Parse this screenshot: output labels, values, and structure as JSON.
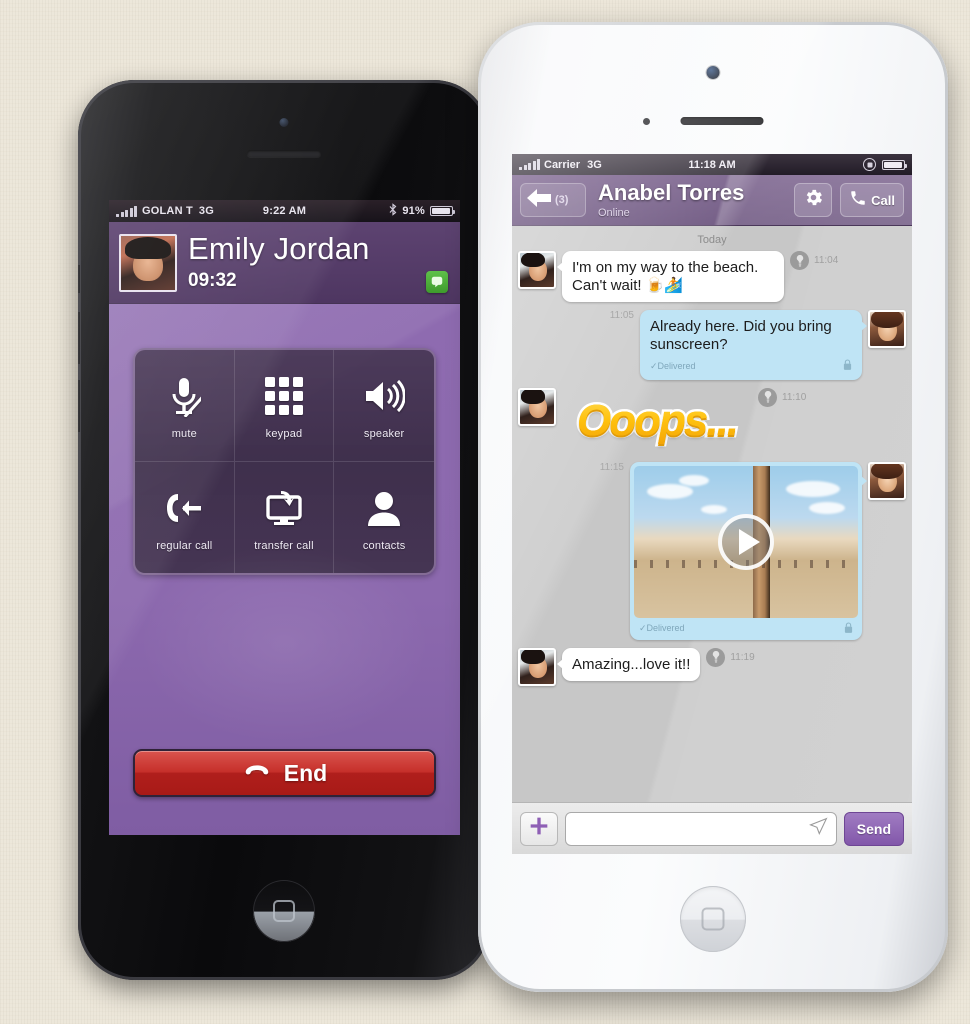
{
  "scene": {
    "background_color": "#ece6d8",
    "accent_purple": "#8e6bb0",
    "accent_dark_purple": "#5b4170",
    "chat_bg": "#c7c7c7",
    "out_bubble": "#bfe4f5",
    "end_red": "#c62f2a"
  },
  "left_phone": {
    "status_bar": {
      "carrier": "GOLAN T",
      "network": "3G",
      "time": "9:22 AM",
      "battery_percent": "91%",
      "bluetooth_icon": "bluetooth-icon"
    },
    "call": {
      "contact_name": "Emily Jordan",
      "duration": "09:32",
      "avatar_name": "caller-avatar",
      "app_badge_icon": "viber-badge-icon",
      "controls": [
        {
          "label": "mute",
          "icon": "microphone-muted-icon"
        },
        {
          "label": "keypad",
          "icon": "dialpad-icon"
        },
        {
          "label": "speaker",
          "icon": "speaker-icon"
        },
        {
          "label": "regular call",
          "icon": "phone-arrow-left-icon"
        },
        {
          "label": "transfer call",
          "icon": "transfer-monitor-icon"
        },
        {
          "label": "contacts",
          "icon": "person-icon"
        }
      ],
      "end_label": "End",
      "end_icon": "hangup-icon"
    }
  },
  "right_phone": {
    "status_bar": {
      "carrier": "Carrier",
      "network": "3G",
      "time": "11:18 AM",
      "lock_icon": "rotation-lock-icon",
      "battery_icon": "battery-icon"
    },
    "nav": {
      "back_icon": "back-arrow-icon",
      "back_count": "(3)",
      "contact_name": "Anabel Torres",
      "status": "Online",
      "settings_icon": "gear-icon",
      "call_icon": "phone-icon",
      "call_label": "Call"
    },
    "chat": {
      "day_separator": "Today",
      "messages": [
        {
          "kind": "text",
          "direction": "in",
          "text": "I'm on my way to the beach. Can't wait! 🍺🏄",
          "time": "11:04",
          "avatar_name": "anabel-avatar",
          "lamp_icon": "lamp-icon"
        },
        {
          "kind": "text",
          "direction": "out",
          "text": "Already here. Did you bring sunscreen?",
          "time": "11:05",
          "status": "✓Delivered",
          "avatar_name": "me-avatar",
          "lock_icon": "lock-icon"
        },
        {
          "kind": "sticker",
          "direction": "in",
          "sticker_text": "Ooops...",
          "time": "11:10",
          "avatar_name": "anabel-avatar",
          "lamp_icon": "lamp-icon"
        },
        {
          "kind": "video",
          "direction": "out",
          "time": "11:15",
          "status": "✓Delivered",
          "play_icon": "play-icon",
          "avatar_name": "me-avatar",
          "lock_icon": "lock-icon"
        },
        {
          "kind": "text",
          "direction": "in",
          "text": "Amazing...love it!!",
          "time": "11:19",
          "avatar_name": "anabel-avatar",
          "lamp_icon": "lamp-icon"
        }
      ]
    },
    "input_bar": {
      "plus_icon": "plus-icon",
      "message_value": "",
      "message_placeholder": "",
      "location_icon": "send-location-icon",
      "send_label": "Send"
    }
  }
}
